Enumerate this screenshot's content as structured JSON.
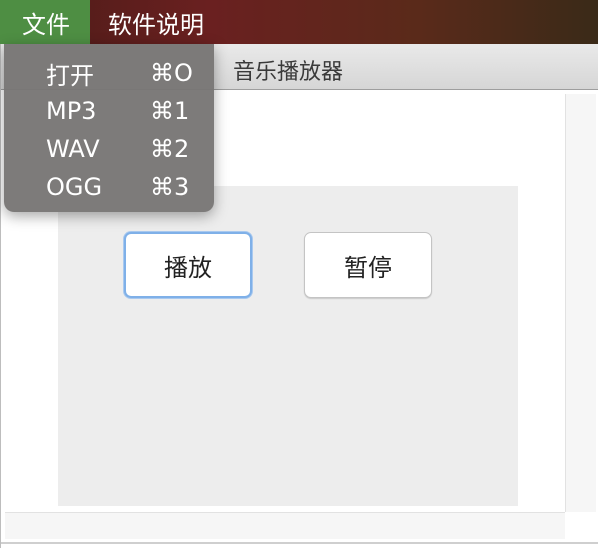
{
  "menubar": {
    "file_menu": "文件",
    "help_menu": "软件说明"
  },
  "file_dropdown": {
    "items": [
      {
        "label": "打开",
        "shortcut": "⌘O"
      },
      {
        "label": "MP3",
        "shortcut": "⌘1"
      },
      {
        "label": "WAV",
        "shortcut": "⌘2"
      },
      {
        "label": "OGG",
        "shortcut": "⌘3"
      }
    ]
  },
  "window": {
    "title": "音乐播放器"
  },
  "controls": {
    "play_label": "播放",
    "pause_label": "暂停"
  },
  "colors": {
    "active_menu": "#4e8e43",
    "focus_ring": "#7fb0e8",
    "panel_bg": "#ededed"
  }
}
